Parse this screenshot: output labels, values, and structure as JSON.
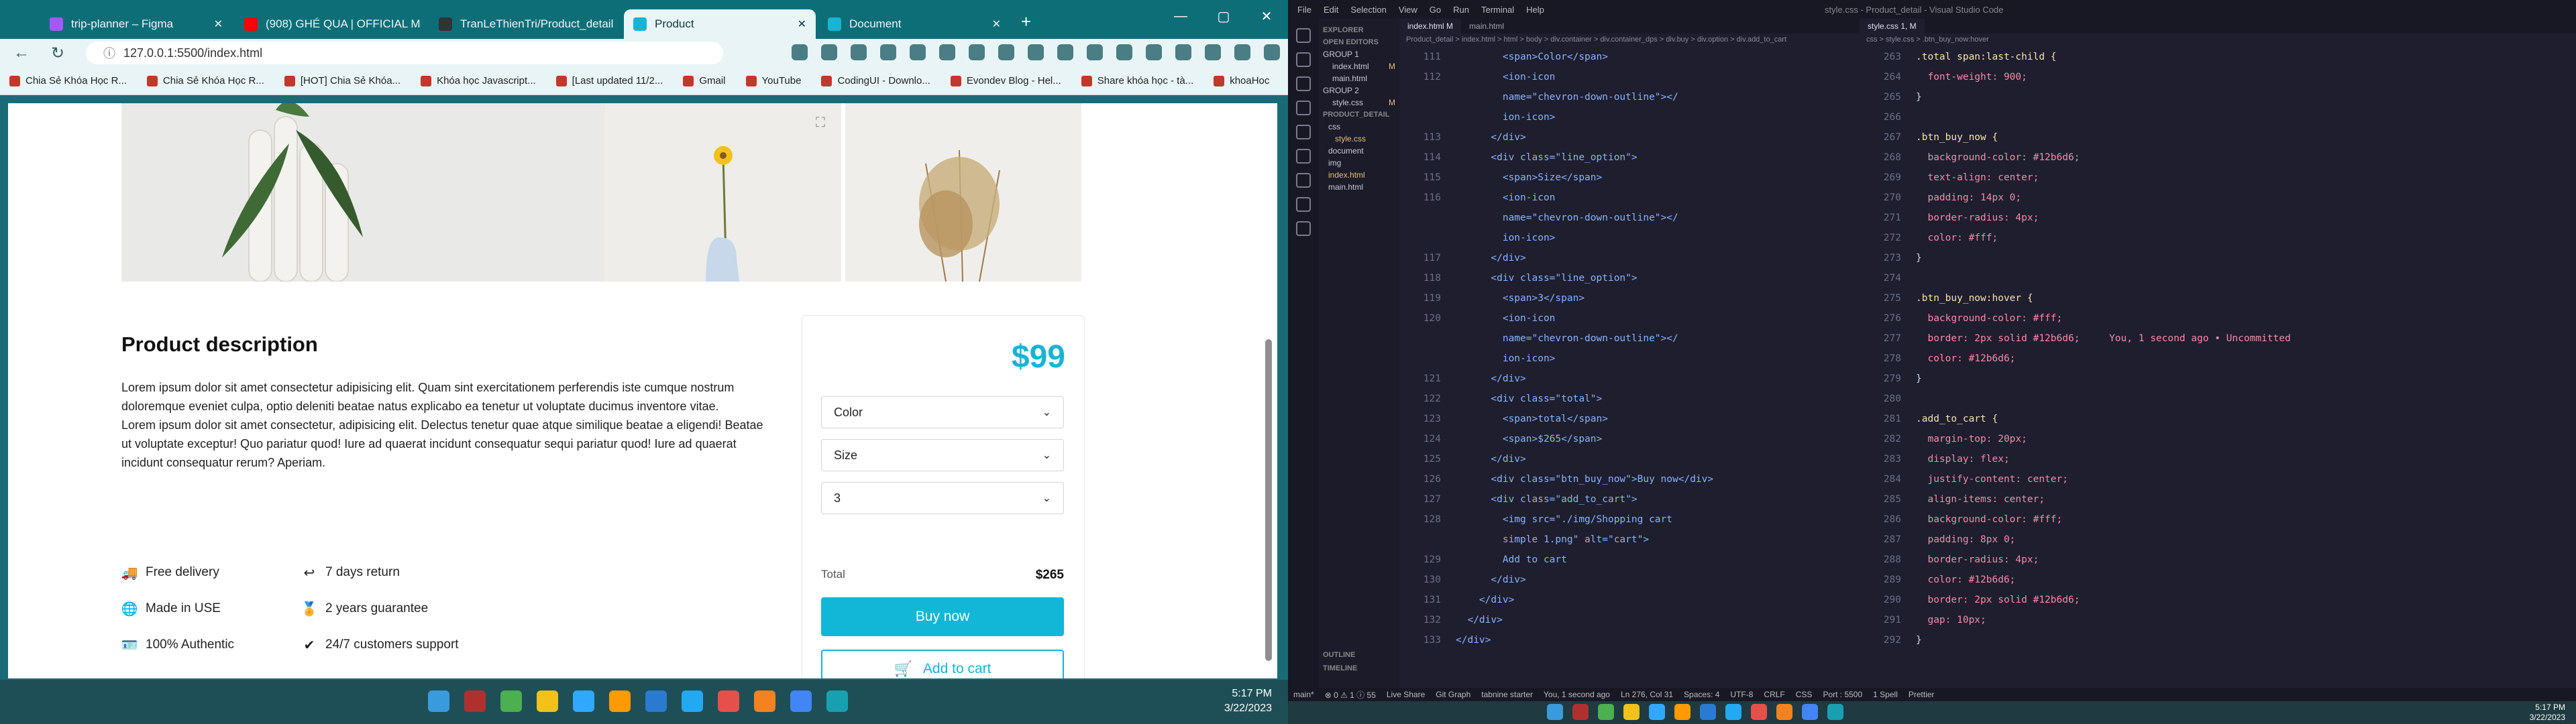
{
  "browser": {
    "tabs": [
      {
        "label": "trip-planner – Figma",
        "color": "#a259ff"
      },
      {
        "label": "(908) GHÉ QUA | OFFICIAL M",
        "color": "#ff0000"
      },
      {
        "label": "TranLeThienTri/Product_detail",
        "color": "#333333"
      },
      {
        "label": "Product",
        "color": "#1bb3d4"
      },
      {
        "label": "Document",
        "color": "#1bb3d4"
      }
    ],
    "active_tab": 3,
    "url": "127.0.0.1:5500/index.html",
    "bookmarks": [
      "Chia Sẻ Khóa Học R...",
      "Chia Sẻ Khóa Học R...",
      "[HOT] Chia Sẻ Khóa...",
      "Khóa học Javascript...",
      "[Last updated 11/2...",
      "Gmail",
      "YouTube",
      "CodingUI - Downlo...",
      "Evondev Blog - Hel...",
      "Share khóa học - tà...",
      "khoaHoc"
    ]
  },
  "page": {
    "desc_title": "Product description",
    "desc_body": "Lorem ipsum dolor sit amet consectetur adipisicing elit. Quam sint exercitationem perferendis iste cumque nostrum doloremque eveniet culpa, optio deleniti beatae natus explicabo ea tenetur ut voluptate ducimus inventore vitae.\nLorem ipsum dolor sit amet consectetur, adipisicing elit. Delectus tenetur quae atque similique beatae a eligendi! Beatae ut voluptate exceptur! Quo pariatur quod! Iure ad quaerat incidunt consequatur sequi pariatur quod! Iure ad quaerat incidunt consequatur rerum? Aperiam.",
    "features": [
      {
        "label": "Free delivery",
        "icon": "truck-icon",
        "glyph": "🚚"
      },
      {
        "label": "7 days return",
        "icon": "return-arrow-icon",
        "glyph": "↩"
      },
      {
        "label": "Made in USE",
        "icon": "globe-icon",
        "glyph": "🌐"
      },
      {
        "label": "2 years guarantee",
        "icon": "medal-icon",
        "glyph": "🏅"
      },
      {
        "label": "100% Authentic",
        "icon": "badge-icon",
        "glyph": "🪪"
      },
      {
        "label": "24/7 customers support",
        "icon": "checkmark-icon",
        "glyph": "✔"
      }
    ],
    "price": "$99",
    "color_label": "Color",
    "size_label": "Size",
    "qty_value": "3",
    "total_label": "Total",
    "total_value": "$265",
    "buy_label": "Buy now",
    "cart_label": "Add to cart",
    "accent": "#12b6d6"
  },
  "taskbar": {
    "time": "5:17 PM",
    "date": "3/22/2023"
  },
  "vscode": {
    "menu": [
      "File",
      "Edit",
      "Selection",
      "View",
      "Go",
      "Run",
      "Terminal",
      "Help"
    ],
    "title": "style.css - Product_detail - Visual Studio Code",
    "explorer": {
      "open_editors": "OPEN EDITORS",
      "group1": "GROUP 1",
      "g1_files": [
        "index.html",
        "main.html"
      ],
      "group2": "GROUP 2",
      "g2_files": [
        "style.css"
      ],
      "project": "PRODUCT_DETAIL",
      "tree": [
        "css",
        "style.css",
        "document",
        "img",
        "index.html",
        "main.html"
      ],
      "outline": "OUTLINE",
      "timeline": "TIMELINE"
    },
    "left_tabs": [
      "index.html M",
      "main.html"
    ],
    "left_crumbs": "Product_detail > index.html > html > body > div.container > div.container_dps > div.buy > div.option > div.add_to_cart",
    "right_tabs": [
      "style.css 1, M"
    ],
    "right_crumbs": "css > style.css > .btn_buy_now:hover",
    "left_code": [
      {
        "n": "111",
        "t": "        <span>Color</span>"
      },
      {
        "n": "112",
        "t": "        <ion-icon"
      },
      {
        "n": "",
        "t": "        name=\"chevron-down-outline\"></"
      },
      {
        "n": "",
        "t": "        ion-icon>"
      },
      {
        "n": "113",
        "t": "      </div>"
      },
      {
        "n": "114",
        "t": "      <div class=\"line_option\">"
      },
      {
        "n": "115",
        "t": "        <span>Size</span>"
      },
      {
        "n": "116",
        "t": "        <ion-icon"
      },
      {
        "n": "",
        "t": "        name=\"chevron-down-outline\"></"
      },
      {
        "n": "",
        "t": "        ion-icon>"
      },
      {
        "n": "117",
        "t": "      </div>"
      },
      {
        "n": "118",
        "t": "      <div class=\"line_option\">"
      },
      {
        "n": "119",
        "t": "        <span>3</span>"
      },
      {
        "n": "120",
        "t": "        <ion-icon"
      },
      {
        "n": "",
        "t": "        name=\"chevron-down-outline\"></"
      },
      {
        "n": "",
        "t": "        ion-icon>"
      },
      {
        "n": "121",
        "t": "      </div>"
      },
      {
        "n": "122",
        "t": "      <div class=\"total\">"
      },
      {
        "n": "123",
        "t": "        <span>total</span>"
      },
      {
        "n": "124",
        "t": "        <span>$265</span>"
      },
      {
        "n": "125",
        "t": "      </div>"
      },
      {
        "n": "126",
        "t": "      <div class=\"btn_buy_now\">Buy now</div>"
      },
      {
        "n": "127",
        "t": "      <div class=\"add_to_cart\">"
      },
      {
        "n": "128",
        "t": "        <img src=\"./img/Shopping cart"
      },
      {
        "n": "",
        "t": "        simple 1.png\" alt=\"cart\">"
      },
      {
        "n": "129",
        "t": "        Add to cart"
      },
      {
        "n": "130",
        "t": "      </div>"
      },
      {
        "n": "131",
        "t": "    </div>"
      },
      {
        "n": "132",
        "t": "  </div>"
      },
      {
        "n": "133",
        "t": "</div>"
      }
    ],
    "right_code": [
      {
        "n": "263",
        "t": ".total span:last-child {"
      },
      {
        "n": "264",
        "t": "  font-weight: 900;"
      },
      {
        "n": "265",
        "t": "}"
      },
      {
        "n": "266",
        "t": ""
      },
      {
        "n": "267",
        "t": ".btn_buy_now {"
      },
      {
        "n": "268",
        "t": "  background-color: #12b6d6;"
      },
      {
        "n": "269",
        "t": "  text-align: center;"
      },
      {
        "n": "270",
        "t": "  padding: 14px 0;"
      },
      {
        "n": "271",
        "t": "  border-radius: 4px;"
      },
      {
        "n": "272",
        "t": "  color: #fff;"
      },
      {
        "n": "273",
        "t": "}"
      },
      {
        "n": "274",
        "t": ""
      },
      {
        "n": "275",
        "t": ".btn_buy_now:hover {"
      },
      {
        "n": "276",
        "t": "  background-color: #fff;"
      },
      {
        "n": "277",
        "t": "  border: 2px solid #12b6d6;     You, 1 second ago • Uncommitted"
      },
      {
        "n": "278",
        "t": "  color: #12b6d6;"
      },
      {
        "n": "279",
        "t": "}"
      },
      {
        "n": "280",
        "t": ""
      },
      {
        "n": "281",
        "t": ".add_to_cart {"
      },
      {
        "n": "282",
        "t": "  margin-top: 20px;"
      },
      {
        "n": "283",
        "t": "  display: flex;"
      },
      {
        "n": "284",
        "t": "  justify-content: center;"
      },
      {
        "n": "285",
        "t": "  align-items: center;"
      },
      {
        "n": "286",
        "t": "  background-color: #fff;"
      },
      {
        "n": "287",
        "t": "  padding: 8px 0;"
      },
      {
        "n": "288",
        "t": "  border-radius: 4px;"
      },
      {
        "n": "289",
        "t": "  color: #12b6d6;"
      },
      {
        "n": "290",
        "t": "  border: 2px solid #12b6d6;"
      },
      {
        "n": "291",
        "t": "  gap: 10px;"
      },
      {
        "n": "292",
        "t": "}"
      }
    ],
    "status": [
      "main*",
      "⊗ 0 ⚠ 1 ⓘ 55",
      "Live Share",
      "Git Graph",
      "tabnine starter",
      "You, 1 second ago",
      "Ln 276, Col 31",
      "Spaces: 4",
      "UTF-8",
      "CRLF",
      "CSS",
      "Port : 5500",
      "1 Spell",
      "Prettier"
    ],
    "time": "5:17 PM",
    "date": "3/22/2023"
  }
}
